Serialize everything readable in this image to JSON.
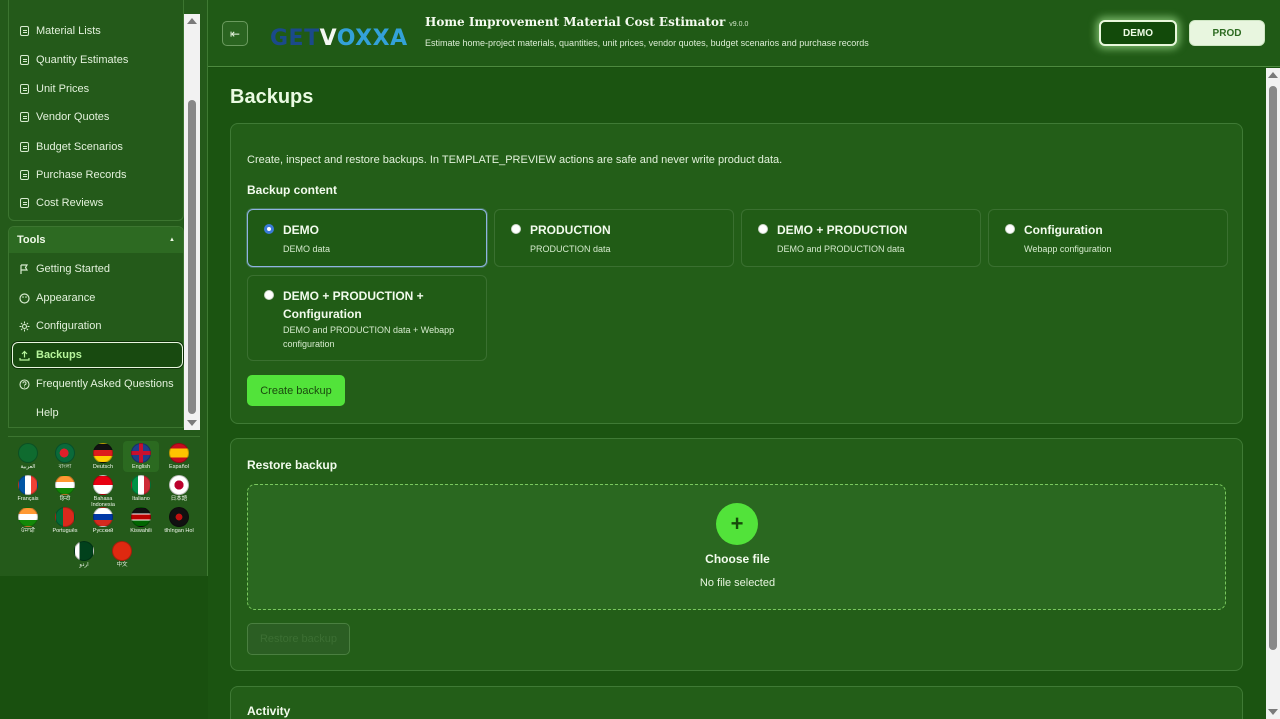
{
  "sidebar": {
    "nav_items": [
      {
        "label": "Material Lists",
        "icon": "document-icon"
      },
      {
        "label": "Quantity Estimates",
        "icon": "document-icon"
      },
      {
        "label": "Unit Prices",
        "icon": "document-icon"
      },
      {
        "label": "Vendor Quotes",
        "icon": "document-icon"
      },
      {
        "label": "Budget Scenarios",
        "icon": "document-icon"
      },
      {
        "label": "Purchase Records",
        "icon": "document-icon"
      },
      {
        "label": "Cost Reviews",
        "icon": "document-icon"
      }
    ],
    "tools": {
      "title": "Tools",
      "collapse_glyph": "▲",
      "items": [
        {
          "label": "Getting Started",
          "icon": "flag-icon"
        },
        {
          "label": "Appearance",
          "icon": "palette-icon"
        },
        {
          "label": "Configuration",
          "icon": "gear-icon"
        },
        {
          "label": "Backups",
          "icon": "upload-icon",
          "active": true
        },
        {
          "label": "Frequently Asked Questions",
          "icon": "help-circle-icon"
        },
        {
          "label": "Help",
          "icon": "none"
        }
      ]
    },
    "languages": [
      {
        "label": "العربية"
      },
      {
        "label": "বাংলা"
      },
      {
        "label": "Deutsch"
      },
      {
        "label": "English"
      },
      {
        "label": "Español"
      },
      {
        "label": "Français"
      },
      {
        "label": "हिन्दी"
      },
      {
        "label": "Bahasa Indonesia"
      },
      {
        "label": "Italiano"
      },
      {
        "label": "日本語"
      },
      {
        "label": "ਪੰਜਾਬੀ"
      },
      {
        "label": "Português"
      },
      {
        "label": "Русский"
      },
      {
        "label": "Kiswahili"
      },
      {
        "label": "tlhIngan Hol"
      },
      {
        "label": "اردو"
      },
      {
        "label": "中文"
      }
    ],
    "selected_language": "English"
  },
  "header": {
    "logo_text_a": "GET",
    "logo_text_v": "V",
    "logo_text_b": "OXXA",
    "title": "Home Improvement Material Cost Estimator",
    "version": "v9.0.0",
    "subtitle": "Estimate home-project materials, quantities, unit prices, vendor quotes, budget scenarios and purchase records",
    "env_demo": "DEMO",
    "env_prod": "PROD",
    "collapse_glyph": "⇤"
  },
  "main": {
    "page_title": "Backups",
    "create_card": {
      "intro": "Create, inspect and restore backups. In TEMPLATE_PREVIEW actions are safe and never write product data.",
      "section_label": "Backup content",
      "options": [
        {
          "title": "DEMO",
          "desc": "DEMO data",
          "selected": true
        },
        {
          "title": "PRODUCTION",
          "desc": "PRODUCTION data"
        },
        {
          "title": "DEMO + PRODUCTION",
          "desc": "DEMO and PRODUCTION data"
        },
        {
          "title": "Configuration",
          "desc": "Webapp configuration"
        },
        {
          "title": "DEMO + PRODUCTION + Configuration",
          "desc": "DEMO and PRODUCTION data + Webapp configuration"
        }
      ],
      "create_button": "Create backup"
    },
    "restore_card": {
      "section_label": "Restore backup",
      "plus_glyph": "+",
      "choose_file": "Choose file",
      "no_file": "No file selected",
      "restore_button": "Restore backup"
    },
    "activity_card": {
      "section_label": "Activity"
    }
  },
  "colors": {
    "background": "#19500f",
    "accent": "#52e33a",
    "active_nav_text": "#b7f59c",
    "radio_selected": "#3a7ad8"
  }
}
